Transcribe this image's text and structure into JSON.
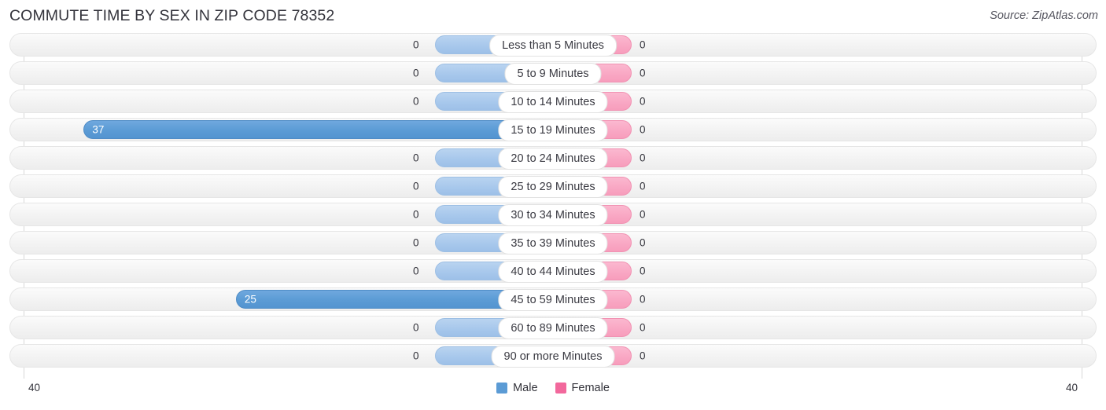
{
  "header": {
    "title": "COMMUTE TIME BY SEX IN ZIP CODE 78352",
    "source": "Source: ZipAtlas.com"
  },
  "legend": {
    "male_label": "Male",
    "female_label": "Female",
    "male_color": "#5b9bd5",
    "female_color": "#f2689c"
  },
  "axis": {
    "left_tick": "40",
    "right_tick": "40"
  },
  "chart_data": {
    "type": "bar",
    "title": "COMMUTE TIME BY SEX IN ZIP CODE 78352",
    "subtitle": "Source: ZipAtlas.com",
    "orientation": "horizontal-diverging",
    "xlabel": "",
    "ylabel": "",
    "xlim": [
      40,
      40
    ],
    "grid": true,
    "legend_position": "bottom-center",
    "categories": [
      "Less than 5 Minutes",
      "5 to 9 Minutes",
      "10 to 14 Minutes",
      "15 to 19 Minutes",
      "20 to 24 Minutes",
      "25 to 29 Minutes",
      "30 to 34 Minutes",
      "35 to 39 Minutes",
      "40 to 44 Minutes",
      "45 to 59 Minutes",
      "60 to 89 Minutes",
      "90 or more Minutes"
    ],
    "series": [
      {
        "name": "Male",
        "color": "#5b9bd5",
        "direction": "left",
        "values": [
          0,
          0,
          0,
          37,
          0,
          0,
          0,
          0,
          0,
          25,
          0,
          0
        ]
      },
      {
        "name": "Female",
        "color": "#f2689c",
        "direction": "right",
        "values": [
          0,
          0,
          0,
          0,
          0,
          0,
          0,
          0,
          0,
          0,
          0,
          0
        ]
      }
    ]
  },
  "rows": [
    {
      "label": "Less than 5 Minutes",
      "male": "0",
      "female": "0"
    },
    {
      "label": "5 to 9 Minutes",
      "male": "0",
      "female": "0"
    },
    {
      "label": "10 to 14 Minutes",
      "male": "0",
      "female": "0"
    },
    {
      "label": "15 to 19 Minutes",
      "male": "37",
      "female": "0"
    },
    {
      "label": "20 to 24 Minutes",
      "male": "0",
      "female": "0"
    },
    {
      "label": "25 to 29 Minutes",
      "male": "0",
      "female": "0"
    },
    {
      "label": "30 to 34 Minutes",
      "male": "0",
      "female": "0"
    },
    {
      "label": "35 to 39 Minutes",
      "male": "0",
      "female": "0"
    },
    {
      "label": "40 to 44 Minutes",
      "male": "0",
      "female": "0"
    },
    {
      "label": "45 to 59 Minutes",
      "male": "25",
      "female": "0"
    },
    {
      "label": "60 to 89 Minutes",
      "male": "0",
      "female": "0"
    },
    {
      "label": "90 or more Minutes",
      "male": "0",
      "female": "0"
    }
  ]
}
